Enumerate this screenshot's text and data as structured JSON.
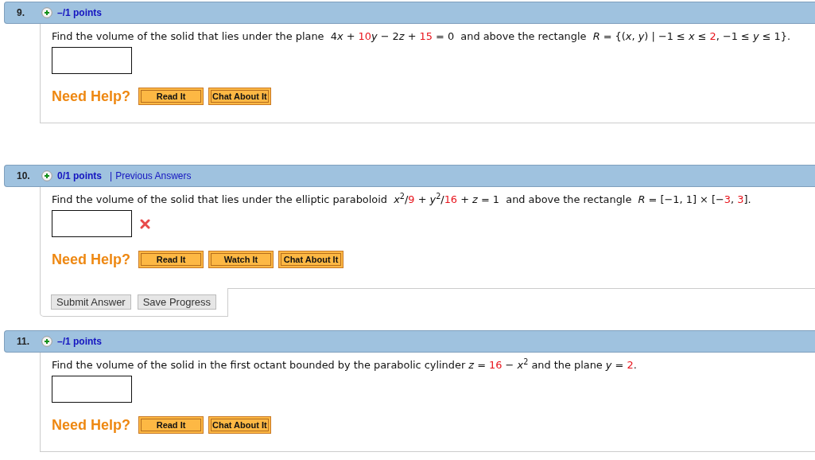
{
  "questions": [
    {
      "number": "9.",
      "points": "–/1 points",
      "parts": [
        {
          "kind": "text",
          "text": "Find the volume of the solid that lies under the plane  4"
        },
        {
          "kind": "var",
          "text": "x"
        },
        {
          "kind": "text",
          "text": " + "
        },
        {
          "kind": "num",
          "text": "10"
        },
        {
          "kind": "var",
          "text": "y"
        },
        {
          "kind": "text",
          "text": " − 2"
        },
        {
          "kind": "var",
          "text": "z"
        },
        {
          "kind": "text",
          "text": " + "
        },
        {
          "kind": "num",
          "text": "15"
        },
        {
          "kind": "text",
          "text": " = 0  and above the rectangle  "
        },
        {
          "kind": "var",
          "text": "R"
        },
        {
          "kind": "text",
          "text": " = {("
        },
        {
          "kind": "var",
          "text": "x"
        },
        {
          "kind": "text",
          "text": ", "
        },
        {
          "kind": "var",
          "text": "y"
        },
        {
          "kind": "text",
          "text": ") | −1 ≤ "
        },
        {
          "kind": "var",
          "text": "x"
        },
        {
          "kind": "text",
          "text": " ≤ "
        },
        {
          "kind": "num",
          "text": "2"
        },
        {
          "kind": "text",
          "text": ", −1 ≤ "
        },
        {
          "kind": "var",
          "text": "y"
        },
        {
          "kind": "text",
          "text": " ≤ 1}."
        }
      ],
      "incorrect": false,
      "help_label": "Need Help?",
      "help_buttons": [
        "Read It",
        "Chat About It"
      ]
    },
    {
      "number": "10.",
      "points": "0/1 points",
      "separator": "|",
      "link": "Previous Answers",
      "parts": [
        {
          "kind": "text",
          "text": "Find the volume of the solid that lies under the elliptic paraboloid  "
        },
        {
          "kind": "var",
          "text": "x"
        },
        {
          "kind": "text",
          "text": "$^{2}$/"
        },
        {
          "kind": "num",
          "text": "9"
        },
        {
          "kind": "text",
          "text": " + "
        },
        {
          "kind": "var",
          "text": "y"
        },
        {
          "kind": "text",
          "text": "$^{2}$/"
        },
        {
          "kind": "num",
          "text": "16"
        },
        {
          "kind": "text",
          "text": " + "
        },
        {
          "kind": "var",
          "text": "z"
        },
        {
          "kind": "text",
          "text": " = 1  and above the rectangle  "
        },
        {
          "kind": "var",
          "text": "R"
        },
        {
          "kind": "text",
          "text": " = [−1, 1] × [−"
        },
        {
          "kind": "num",
          "text": "3"
        },
        {
          "kind": "text",
          "text": ", "
        },
        {
          "kind": "num",
          "text": "3"
        },
        {
          "kind": "text",
          "text": "]."
        }
      ],
      "incorrect": true,
      "help_label": "Need Help?",
      "help_buttons": [
        "Read It",
        "Watch It",
        "Chat About It"
      ],
      "actions": [
        "Submit Answer",
        "Save Progress"
      ]
    },
    {
      "number": "11.",
      "points": "–/1 points",
      "parts": [
        {
          "kind": "text",
          "text": "Find the volume of the solid in the first octant bounded by the parabolic cylinder "
        },
        {
          "kind": "var",
          "text": "z"
        },
        {
          "kind": "text",
          "text": " = "
        },
        {
          "kind": "num",
          "text": "16"
        },
        {
          "kind": "text",
          "text": " − "
        },
        {
          "kind": "var",
          "text": "x"
        },
        {
          "kind": "text",
          "text": "$^{2}$ and the plane "
        },
        {
          "kind": "var",
          "text": "y"
        },
        {
          "kind": "text",
          "text": " = "
        },
        {
          "kind": "num",
          "text": "2"
        },
        {
          "kind": "text",
          "text": "."
        }
      ],
      "incorrect": false,
      "help_label": "Need Help?",
      "help_buttons": [
        "Read It",
        "Chat About It"
      ]
    }
  ]
}
